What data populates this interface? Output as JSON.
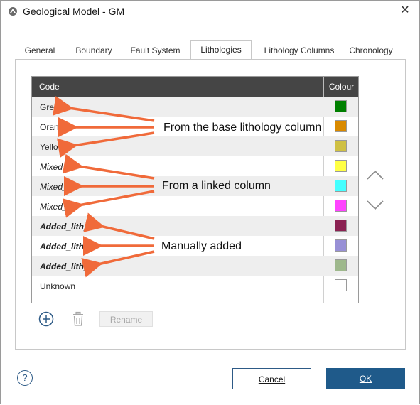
{
  "window": {
    "title": "Geological Model - GM",
    "close_glyph": "✕"
  },
  "tabs": [
    {
      "label": "General"
    },
    {
      "label": "Boundary"
    },
    {
      "label": "Fault System"
    },
    {
      "label": "Lithologies",
      "active": true
    },
    {
      "label": "Lithology Columns"
    },
    {
      "label": "Chronology"
    }
  ],
  "table": {
    "headers": {
      "code": "Code",
      "colour": "Colour"
    },
    "rows": [
      {
        "code": "Green",
        "style": "normal",
        "colour": "#007f00"
      },
      {
        "code": "Orange",
        "style": "normal",
        "colour": "#d98a00"
      },
      {
        "code": "Yellow",
        "style": "normal",
        "colour": "#cfc043"
      },
      {
        "code": "Mixed_A",
        "style": "italic",
        "colour": "#ffff44"
      },
      {
        "code": "Mixed_B",
        "style": "italic",
        "colour": "#44ffff"
      },
      {
        "code": "Mixed_C",
        "style": "italic",
        "colour": "#ff44ff"
      },
      {
        "code": "Added_lith_A",
        "style": "bold-italic",
        "colour": "#8b2252"
      },
      {
        "code": "Added_lith_B",
        "style": "bold-italic",
        "colour": "#9890d6"
      },
      {
        "code": "Added_lith_C",
        "style": "bold-italic",
        "colour": "#9eb88c"
      },
      {
        "code": "Unknown",
        "style": "normal",
        "colour": "#ffffff"
      }
    ]
  },
  "annotations": {
    "base": "From the base lithology column",
    "linked": "From a linked column",
    "manual": "Manually added",
    "arrow_color": "#f06a3a"
  },
  "controls": {
    "move_up_icon": "chevron-up-icon",
    "move_down_icon": "chevron-down-icon",
    "add_icon": "plus-circle-icon",
    "delete_icon": "trash-icon",
    "rename_label": "Rename"
  },
  "footer": {
    "help_label": "?",
    "cancel_label": "Cancel",
    "ok_label": "OK"
  }
}
